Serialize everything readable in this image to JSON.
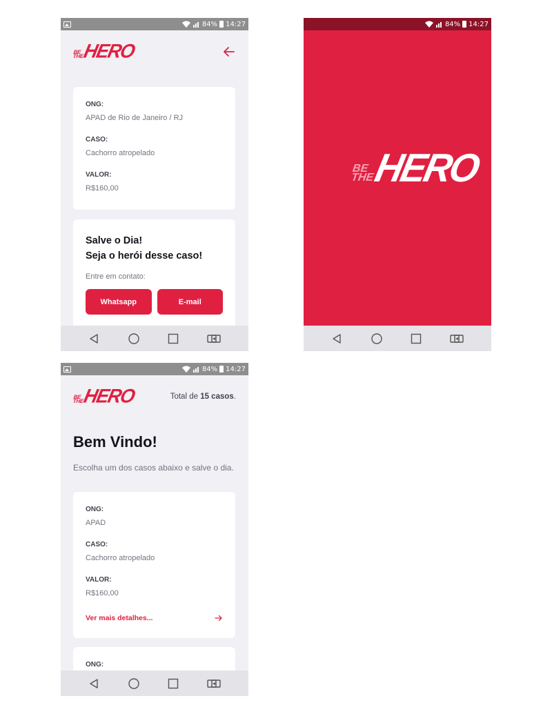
{
  "status_bar": {
    "battery": "84%",
    "time": "14:27"
  },
  "logo": {
    "be": "BE",
    "the": "THE",
    "hero": "HERO"
  },
  "detail_screen": {
    "incident": {
      "ong_label": "ONG:",
      "ong_value": "APAD de Rio de Janeiro / RJ",
      "case_label": "CASO:",
      "case_value": "Cachorro atropelado",
      "value_label": "VALOR:",
      "value_value": "R$160,00"
    },
    "contact": {
      "title_line1": "Salve o Dia!",
      "title_line2": "Seja o herói desse caso!",
      "description": "Entre em contato:",
      "whatsapp_label": "Whatsapp",
      "email_label": "E-mail"
    }
  },
  "list_screen": {
    "total_prefix": "Total de ",
    "total_count": "15 casos",
    "total_suffix": ".",
    "title": "Bem Vindo!",
    "description": "Escolha um dos casos abaixo e salve o dia.",
    "incidents": [
      {
        "ong_label": "ONG:",
        "ong_value": "APAD",
        "case_label": "CASO:",
        "case_value": "Cachorro atropelado",
        "value_label": "VALOR:",
        "value_value": "R$160,00",
        "details_label": "Ver mais detalhes..."
      },
      {
        "ong_label": "ONG:"
      }
    ]
  },
  "colors": {
    "brand": "#e02041",
    "background": "#f0f0f5"
  }
}
